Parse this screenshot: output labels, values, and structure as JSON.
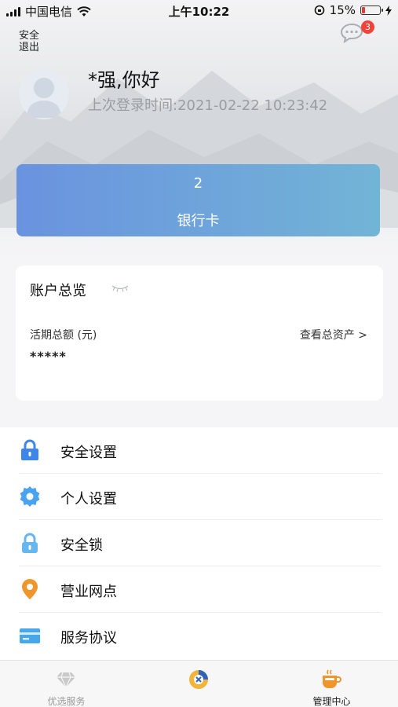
{
  "status_bar": {
    "carrier": "中国电信",
    "time": "上午10:22",
    "battery_percent": "15%"
  },
  "header": {
    "logout_label": "安全退出",
    "message_badge": "3",
    "greeting": "*强,你好",
    "last_login": "上次登录时间:2021-02-22 10:23:42"
  },
  "bank_card": {
    "count": "2",
    "label": "银行卡"
  },
  "overview": {
    "title": "账户总览",
    "current_label": "活期总额 (元)",
    "view_all": "查看总资产 >",
    "masked_value": "*****"
  },
  "menu": {
    "items": [
      {
        "label": "安全设置",
        "icon": "lock-icon",
        "color": "#3f86ea"
      },
      {
        "label": "个人设置",
        "icon": "gear-icon",
        "color": "#4aa3ef"
      },
      {
        "label": "安全锁",
        "icon": "padlock-icon",
        "color": "#67b6ee"
      },
      {
        "label": "营业网点",
        "icon": "location-pin-icon",
        "color": "#f0952b"
      },
      {
        "label": "服务协议",
        "icon": "card-icon",
        "color": "#46a8ea"
      }
    ]
  },
  "tabbar": {
    "tabs": [
      {
        "label": "优选服务",
        "icon": "diamond-icon",
        "active": false
      },
      {
        "label": "",
        "icon": "bank-logo-icon",
        "active": false
      },
      {
        "label": "管理中心",
        "icon": "coffee-cup-icon",
        "active": true
      }
    ]
  },
  "colors": {
    "card_start": "#6a93df",
    "card_end": "#72b4d6",
    "badge": "#f0443a",
    "tab_active": "#222222",
    "tab_inactive": "#9a9a9a"
  }
}
